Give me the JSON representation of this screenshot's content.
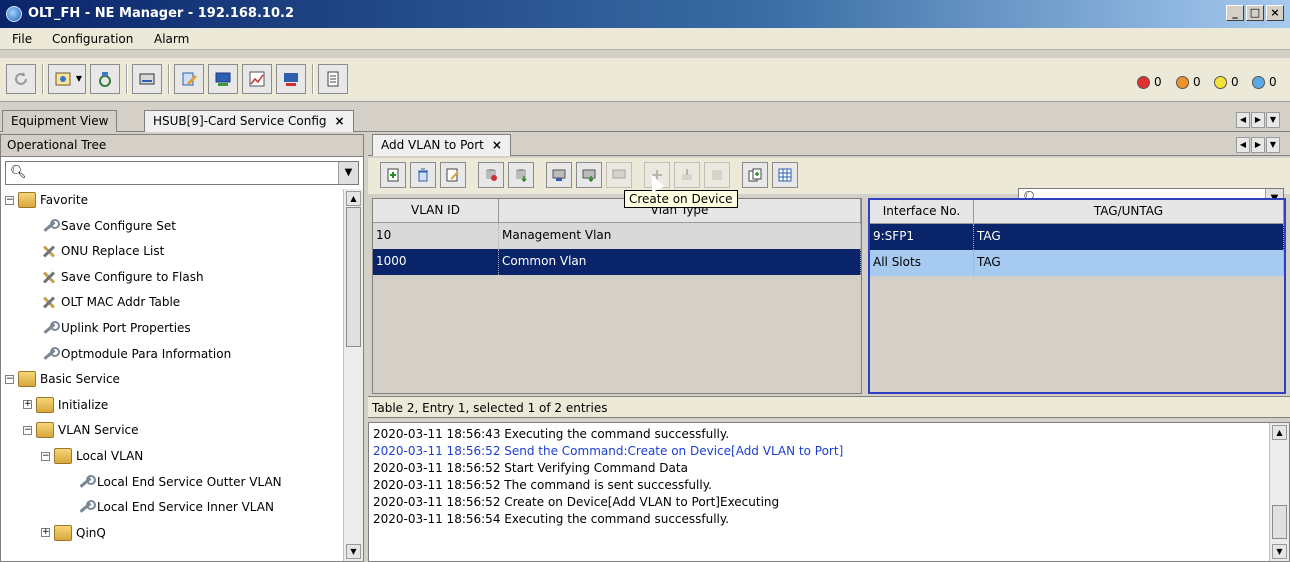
{
  "window": {
    "title": "OLT_FH - NE Manager - 192.168.10.2"
  },
  "menu": {
    "items": [
      "File",
      "Configuration",
      "Alarm"
    ]
  },
  "alarms": [
    {
      "color": "#e03030",
      "count": "0"
    },
    {
      "color": "#f0922a",
      "count": "0"
    },
    {
      "color": "#f2e23a",
      "count": "0"
    },
    {
      "color": "#5aa8e6",
      "count": "0"
    }
  ],
  "tabs": [
    {
      "label": "Equipment View"
    },
    {
      "label": "HSUB[9]-Card Service Config",
      "close": "×"
    }
  ],
  "left_panel": {
    "header": "Operational Tree",
    "tree": [
      {
        "label": "Favorite",
        "indent": 0,
        "icon": "folder",
        "expander": "−"
      },
      {
        "label": "Save Configure Set",
        "indent": 1,
        "icon": "wrench"
      },
      {
        "label": "ONU Replace List",
        "indent": 1,
        "icon": "tools"
      },
      {
        "label": "Save Configure to Flash",
        "indent": 1,
        "icon": "tools"
      },
      {
        "label": "OLT MAC Addr Table",
        "indent": 1,
        "icon": "tools"
      },
      {
        "label": "Uplink Port Properties",
        "indent": 1,
        "icon": "wrench"
      },
      {
        "label": "Optmodule Para Information",
        "indent": 1,
        "icon": "wrench"
      },
      {
        "label": "Basic Service",
        "indent": 0,
        "icon": "folder",
        "expander": "−"
      },
      {
        "label": "Initialize",
        "indent": 1,
        "icon": "folder",
        "expander": "+"
      },
      {
        "label": "VLAN Service",
        "indent": 1,
        "icon": "folder",
        "expander": "−"
      },
      {
        "label": "Local VLAN",
        "indent": 2,
        "icon": "folder",
        "expander": "−"
      },
      {
        "label": "Local End Service Outter VLAN",
        "indent": 3,
        "icon": "wrench"
      },
      {
        "label": "Local End Service Inner VLAN",
        "indent": 3,
        "icon": "wrench"
      },
      {
        "label": "QinQ",
        "indent": 2,
        "icon": "folder",
        "expander": "+"
      }
    ]
  },
  "subtab": {
    "label": "Add VLAN to Port",
    "close": "×"
  },
  "tooltip": "Create on Device",
  "vlan_table": {
    "headers": [
      "VLAN ID",
      "Vlan Type"
    ],
    "rows": [
      {
        "id": "10",
        "type": "Management Vlan",
        "state": "light"
      },
      {
        "id": "1000",
        "type": "Common Vlan",
        "state": "selected"
      }
    ]
  },
  "port_table": {
    "headers": [
      "Interface No.",
      "TAG/UNTAG"
    ],
    "rows": [
      {
        "iface": "9:SFP1",
        "tag": "TAG",
        "state": "selected"
      },
      {
        "iface": "All Slots",
        "tag": "TAG",
        "state": "light-selected"
      }
    ]
  },
  "status": "Table 2, Entry 1, selected 1 of 2 entries",
  "log": [
    {
      "text": "2020-03-11 18:56:43 Executing the command successfully.",
      "blue": false
    },
    {
      "text": "2020-03-11 18:56:52 Send the Command:Create on Device[Add VLAN to Port]",
      "blue": true
    },
    {
      "text": "2020-03-11 18:56:52 Start Verifying Command Data",
      "blue": false
    },
    {
      "text": "2020-03-11 18:56:52 The command is sent successfully.",
      "blue": false
    },
    {
      "text": "2020-03-11 18:56:52 Create on Device[Add VLAN to Port]Executing",
      "blue": false
    },
    {
      "text": "2020-03-11 18:56:54 Executing the command successfully.",
      "blue": false
    }
  ]
}
